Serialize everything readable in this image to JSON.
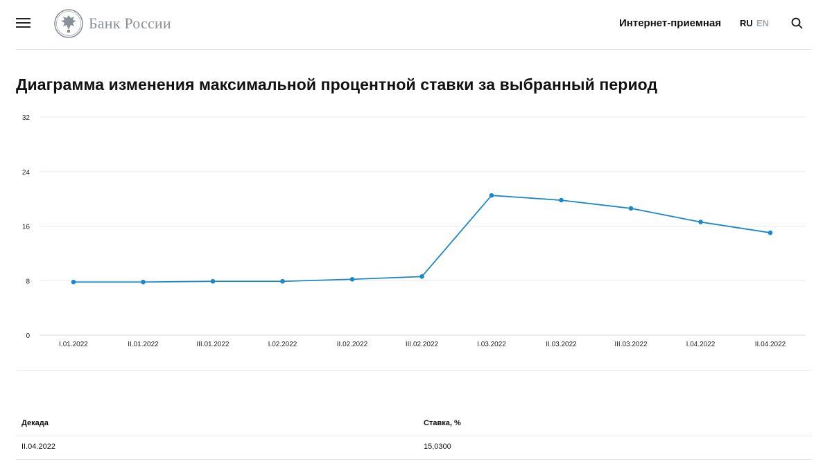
{
  "header": {
    "logo_text": "Банк России",
    "reception_label": "Интернет-приемная",
    "lang_ru": "RU",
    "lang_en": "EN",
    "icons": [
      "menu-icon",
      "bank-emblem-icon",
      "search-icon"
    ]
  },
  "page": {
    "title": "Диаграмма изменения максимальной процентной ставки за выбранный период"
  },
  "colors": {
    "accent": "#1a87c9",
    "lang_inactive": "#a3a8b0",
    "grid": "#e8e9ec",
    "logo_text": "#8a8f98"
  },
  "chart_data": {
    "type": "line",
    "categories": [
      "I.01.2022",
      "II.01.2022",
      "III.01.2022",
      "I.02.2022",
      "II.02.2022",
      "III.02.2022",
      "I.03.2022",
      "II.03.2022",
      "III.03.2022",
      "I.04.2022",
      "II.04.2022"
    ],
    "series": [
      {
        "values": [
          7.8,
          7.8,
          7.9,
          7.9,
          8.2,
          8.6,
          20.5,
          19.8,
          18.6,
          16.6,
          15.03
        ]
      }
    ],
    "yticks": [
      "0",
      "8",
      "16",
      "24",
      "32"
    ],
    "ylim": [
      0,
      32
    ],
    "grid": true
  },
  "table": {
    "headers": [
      "Декада",
      "Ставка, %"
    ],
    "rows": [
      [
        "II.04.2022",
        "15,0300"
      ]
    ]
  }
}
